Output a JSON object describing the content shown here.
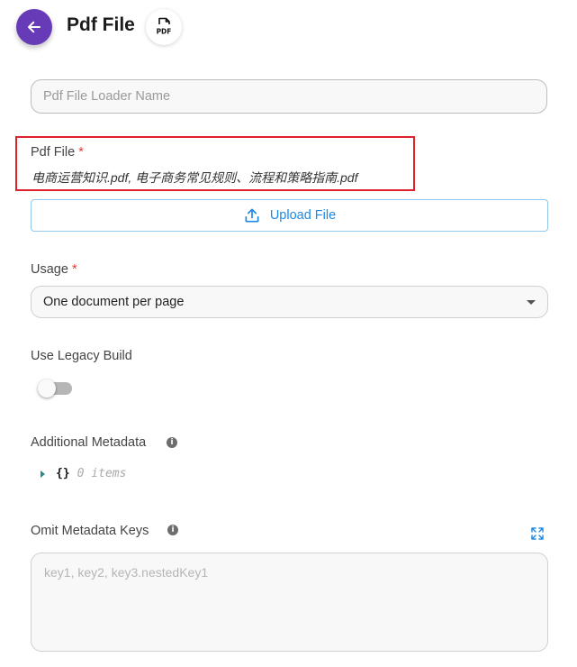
{
  "header": {
    "title": "Pdf File",
    "back_icon": "arrow-left-icon",
    "node_icon": "pdf-icon",
    "badge_text": "PDF",
    "accent_color": "#673ab7"
  },
  "fields": {
    "loader_name": {
      "placeholder": "Pdf File Loader Name",
      "value": ""
    },
    "pdf_file": {
      "label": "Pdf File",
      "required_mark": "*",
      "file_names": "电商运营知识.pdf, 电子商务常见规则、流程和策略指南.pdf",
      "upload_label": "Upload File",
      "upload_icon": "upload-icon"
    },
    "usage": {
      "label": "Usage",
      "required_mark": "*",
      "selected": "One document per page"
    },
    "legacy_build": {
      "label": "Use Legacy Build",
      "enabled": false
    },
    "additional_metadata": {
      "label": "Additional Metadata",
      "info_glyph": "i",
      "braces": "{}",
      "items_text": "0 items"
    },
    "omit_metadata_keys": {
      "label": "Omit Metadata Keys",
      "info_glyph": "i",
      "placeholder": "key1, key2, key3.nestedKey1",
      "value": ""
    }
  },
  "colors": {
    "highlight_border": "#e0202a",
    "link_blue": "#1e88e5",
    "required_red": "#e53935"
  }
}
